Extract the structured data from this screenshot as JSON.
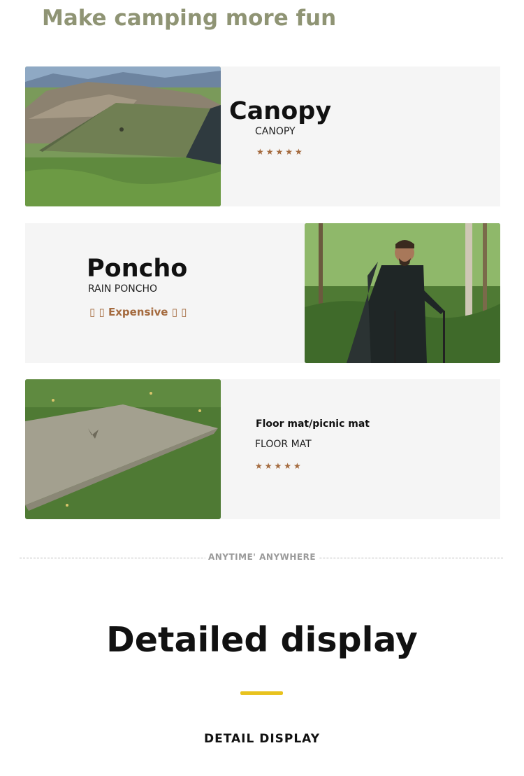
{
  "headline": "Make camping more fun",
  "products": [
    {
      "title": "Canopy",
      "subtitle": "CANOPY",
      "stars": "★★★★★"
    },
    {
      "title": "Poncho",
      "subtitle": "RAIN PONCHO",
      "rating_text": "▯ ▯ Expensive ▯ ▯"
    },
    {
      "title": "Floor mat/picnic mat",
      "subtitle": "FLOOR MAT",
      "stars": "★★★★★"
    }
  ],
  "divider_text": "ANYTIME' ANYWHERE",
  "section_title": "Detailed display",
  "section_caption": "DETAIL DISPLAY",
  "colors": {
    "headline": "#8f9474",
    "stars": "#a46a3e",
    "accent": "#e8c21e",
    "card_bg": "#f5f5f5"
  }
}
